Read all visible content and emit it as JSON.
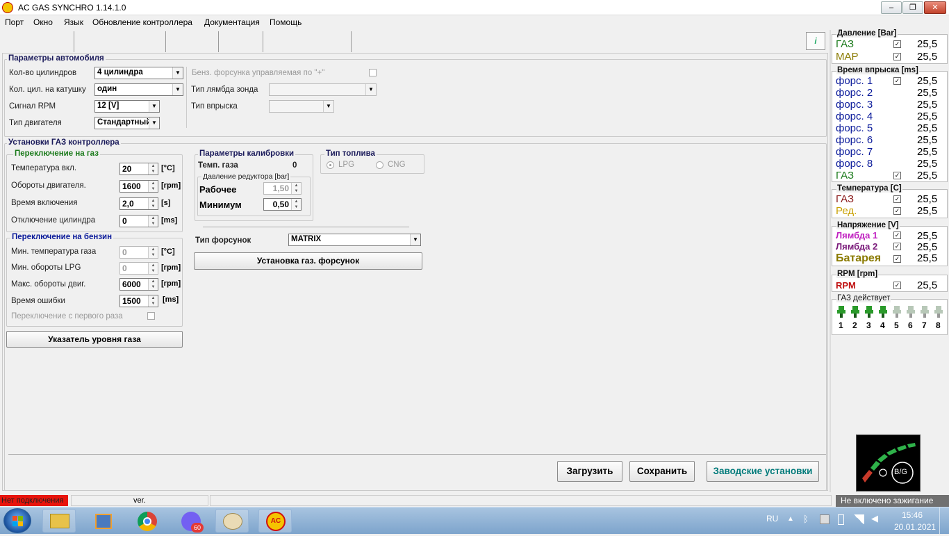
{
  "window": {
    "title": "AC GAS SYNCHRO   1.14.1.0"
  },
  "menu": [
    "Порт",
    "Окно",
    "Язык",
    "Обновление контроллера",
    "Документация",
    "Помощь"
  ],
  "car": {
    "title": "Параметры автомобиля",
    "cylinders_label": "Кол-во цилиндров",
    "cylinders_value": "4 цилиндра",
    "coil_label": "Кол. цил. на катушку",
    "coil_value": "один",
    "rpm_signal_label": "Сигнал RPM",
    "rpm_signal_value": "12 [V]",
    "engine_type_label": "Тип двигателя",
    "engine_type_value": "Стандартный",
    "petrol_injector_label": "Бенз. форсунка управляемая по \"+\"",
    "lambda_label": "Тип лямбда зонда",
    "injection_label": "Тип впрыска"
  },
  "gas": {
    "title": "Установки ГАЗ контроллера",
    "to_gas": {
      "title": "Переключение на газ",
      "rows": [
        {
          "label": "Температура вкл.",
          "value": "20",
          "unit": "[°C]"
        },
        {
          "label": "Обороты двигателя.",
          "value": "1600",
          "unit": "[rpm]"
        },
        {
          "label": "Время включения",
          "value": "2,0",
          "unit": "[s]"
        },
        {
          "label": "Отключение цилиндра",
          "value": "0",
          "unit": "[ms]"
        }
      ]
    },
    "to_petrol": {
      "title": "Переключение на бензин",
      "rows": [
        {
          "label": "Мин. температура газа",
          "value": "0",
          "unit": "[°C]"
        },
        {
          "label": "Мин. обороты LPG",
          "value": "0",
          "unit": "[rpm]"
        },
        {
          "label": "Макс. обороты двиг.",
          "value": "6000",
          "unit": "[rpm]"
        },
        {
          "label": "Время ошибки",
          "value": "1500",
          "unit": "[ms]"
        }
      ],
      "first_time_label": "Переключение с первого раза"
    },
    "gas_level_button": "Указатель уровня газа",
    "calib": {
      "title": "Параметры калибровки",
      "temp_label": "Темп. газа",
      "temp_value": "0",
      "reducer_title": "Давление редуктора [bar]",
      "work_label": "Рабочее",
      "work_value": "1,50",
      "min_label": "Минимум",
      "min_value": "0,50"
    },
    "fuel": {
      "title": "Тип топлива",
      "lpg": "LPG",
      "cng": "CNG"
    },
    "injector_type_label": "Тип форсунок",
    "injector_type_value": "MATRIX",
    "injector_setup_button": "Установка газ. форсунок"
  },
  "buttons": {
    "load": "Загрузить",
    "save": "Сохранить",
    "factory": "Заводские установки"
  },
  "monitor": {
    "pressure": {
      "title": "Давление [Bar]",
      "rows": [
        {
          "name": "ГАЗ",
          "value": "25,5",
          "color": "#1a7a1a"
        },
        {
          "name": "MAP",
          "value": "25,5",
          "color": "#8a7a00"
        }
      ]
    },
    "injection": {
      "title": "Время впрыска [ms]",
      "rows": [
        {
          "name": "форс. 1",
          "value": "25,5",
          "color": "#0a1a9a"
        },
        {
          "name": "форс. 2",
          "value": "25,5",
          "color": "#0a1a9a"
        },
        {
          "name": "форс. 3",
          "value": "25,5",
          "color": "#0a1a9a"
        },
        {
          "name": "форс. 4",
          "value": "25,5",
          "color": "#0a1a9a"
        },
        {
          "name": "форс. 5",
          "value": "25,5",
          "color": "#0a1a9a"
        },
        {
          "name": "форс. 6",
          "value": "25,5",
          "color": "#0a1a9a"
        },
        {
          "name": "форс. 7",
          "value": "25,5",
          "color": "#0a1a9a"
        },
        {
          "name": "форс. 8",
          "value": "25,5",
          "color": "#0a1a9a"
        },
        {
          "name": "ГАЗ",
          "value": "25,5",
          "color": "#1a7a1a"
        }
      ]
    },
    "temperature": {
      "title": "Температура  [C]",
      "rows": [
        {
          "name": "ГАЗ",
          "value": "25,5",
          "color": "#8a1a1a"
        },
        {
          "name": "Ред.",
          "value": "25,5",
          "color": "#c8a000"
        }
      ]
    },
    "voltage": {
      "title": "Напряжение [V]",
      "rows": [
        {
          "name": "Лямбда 1",
          "value": "25,5",
          "color": "#c020c0"
        },
        {
          "name": "Лямбда 2",
          "value": "25,5",
          "color": "#7a1a7a"
        },
        {
          "name": "Батарея",
          "value": "25,5",
          "color": "#8a7a00"
        }
      ]
    },
    "rpm": {
      "title": "RPM [rpm]",
      "rows": [
        {
          "name": "RPM",
          "value": "25,5",
          "color": "#c01010"
        }
      ]
    },
    "gas_active": {
      "title": "ГАЗ действует",
      "injectors": [
        "1",
        "2",
        "3",
        "4",
        "5",
        "6",
        "7",
        "8"
      ],
      "active_count": 4
    }
  },
  "badge": "B/G",
  "status": {
    "connection": "Нет подключения",
    "ver": "ver.",
    "ignition": "Не включено зажигание"
  },
  "tray": {
    "lang": "RU",
    "time": "15:46",
    "date": "20.01.2021",
    "viber_badge": "60"
  }
}
